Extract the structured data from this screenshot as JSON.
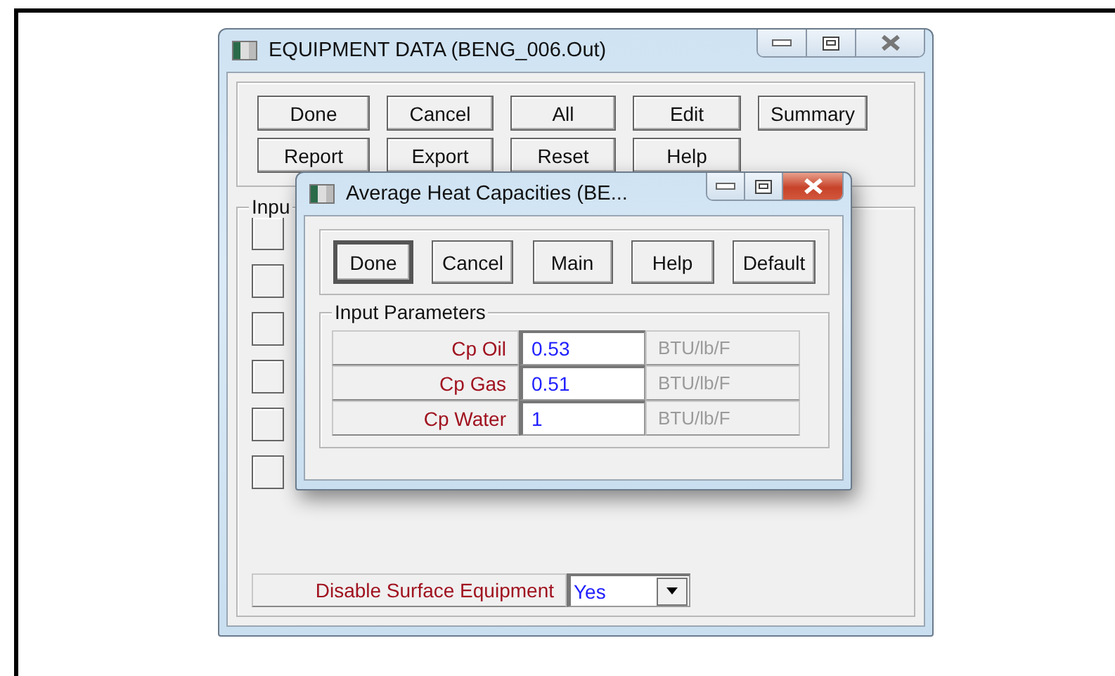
{
  "main_window": {
    "title": "EQUIPMENT DATA (BENG_006.Out)",
    "button_rows": [
      [
        "Done",
        "Cancel",
        "All",
        "Edit",
        "Summary"
      ],
      [
        "Report",
        "Export",
        "Reset",
        "Help"
      ]
    ],
    "group_label": "Inpu",
    "disable_field": {
      "label": "Disable Surface Equipment",
      "value": "Yes"
    }
  },
  "dialog": {
    "title": "Average Heat Capacities (BE...",
    "buttons": [
      {
        "label": "Done",
        "default": true
      },
      {
        "label": "Cancel",
        "default": false
      },
      {
        "label": "Main",
        "default": false
      },
      {
        "label": "Help",
        "default": false
      },
      {
        "label": "Default",
        "default": false
      }
    ],
    "group_label": "Input Parameters",
    "rows": [
      {
        "label": "Cp Oil",
        "value": "0.53",
        "unit": "BTU/lb/F"
      },
      {
        "label": "Cp Gas",
        "value": "0.51",
        "unit": "BTU/lb/F"
      },
      {
        "label": "Cp Water",
        "value": "1",
        "unit": "BTU/lb/F"
      }
    ]
  }
}
